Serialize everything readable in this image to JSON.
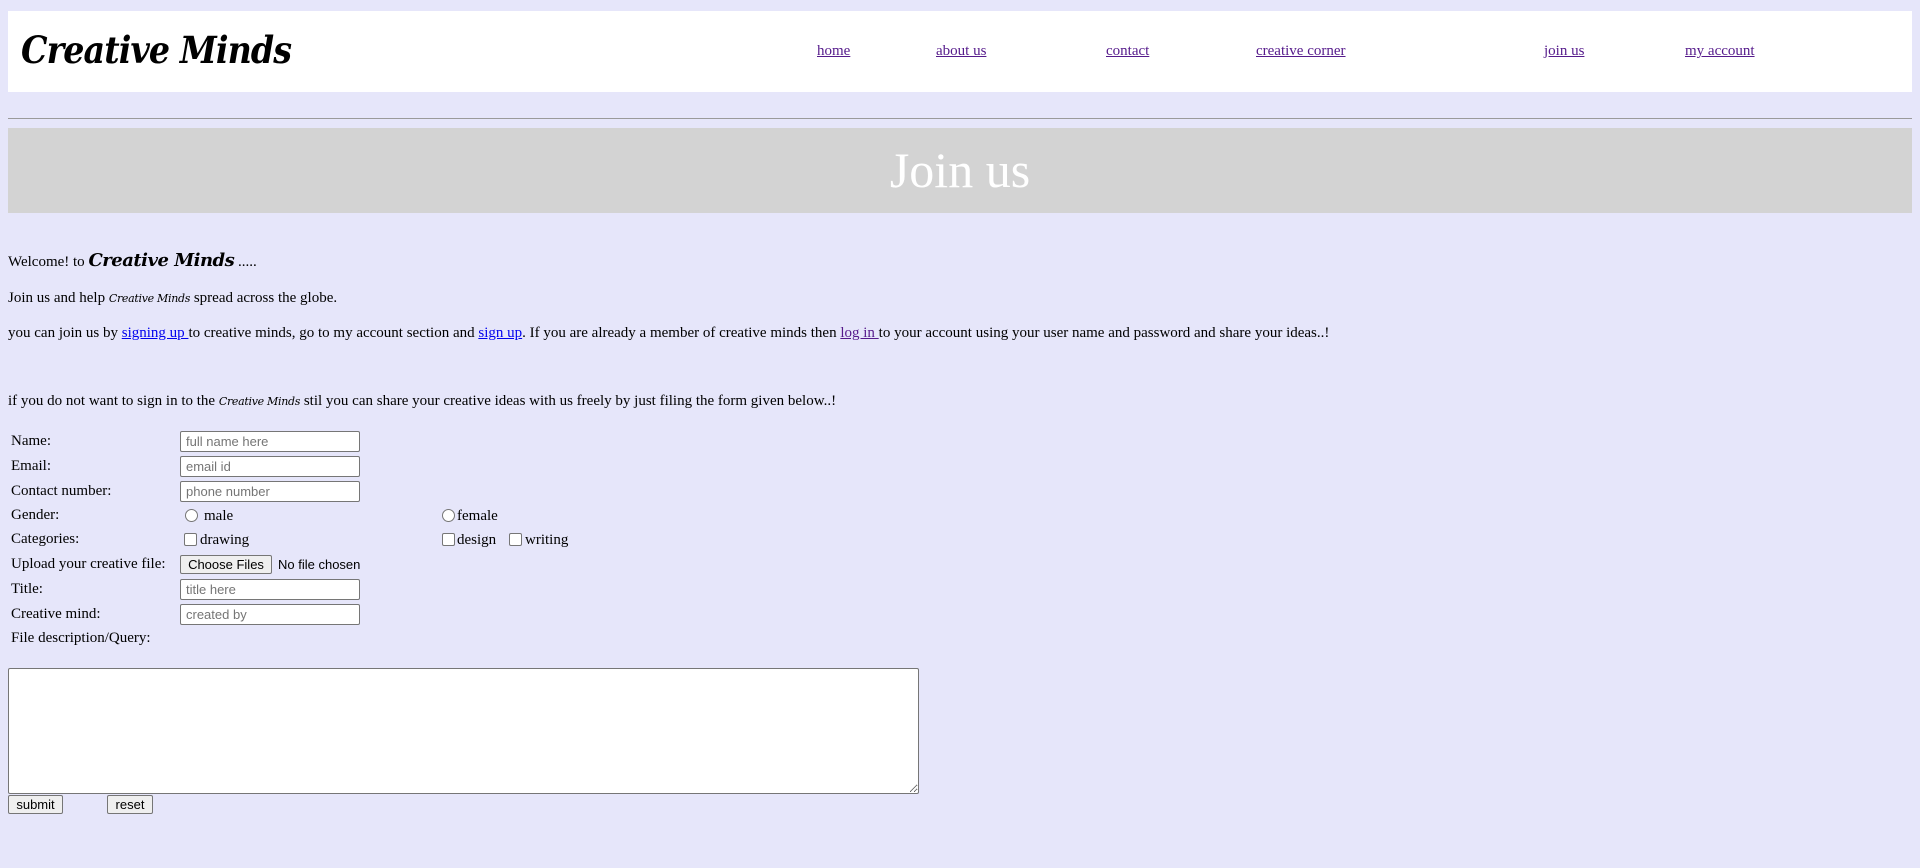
{
  "header": {
    "logo": "Creative Minds",
    "nav": [
      "home",
      "about us",
      "contact",
      "creative corner",
      "join us",
      "my account"
    ]
  },
  "banner": {
    "title": "Join us"
  },
  "intro": {
    "welcome_prefix": "Welcome! to ",
    "brand": "Creative Minds",
    "welcome_suffix": " .....",
    "help_prefix": "Join us and help ",
    "help_suffix": " spread across the globe.",
    "join_prefix": "you can join us by ",
    "signing_up_link": "signing up ",
    "join_mid1": "to creative minds, go to my account section and ",
    "sign_up_link": "sign up",
    "join_mid2": ". If you are already a member of creative minds then ",
    "log_in_link": "log in ",
    "join_suffix": "to your account using your user name and password and share your ideas..!",
    "share_prefix": "if you do not want to sign in to the ",
    "share_suffix": " stil you can share your creative ideas with us freely by just filing the form given below..!"
  },
  "form": {
    "name_label": "Name:",
    "name_placeholder": "full name here",
    "email_label": "Email:",
    "email_placeholder": "email id",
    "contact_label": "Contact number:",
    "contact_placeholder": "phone number",
    "gender_label": "Gender:",
    "gender_options": [
      "male",
      "female"
    ],
    "categories_label": "Categories:",
    "category_options": [
      "drawing",
      "design",
      "writing"
    ],
    "upload_label": "Upload your creative file:",
    "file_button": "Choose Files",
    "file_status": "No file chosen",
    "title_label": "Title:",
    "title_placeholder": "title here",
    "creative_mind_label": "Creative mind:",
    "creative_mind_placeholder": "created by",
    "description_label": "File description/Query:",
    "submit_label": "submit",
    "reset_label": "reset"
  }
}
